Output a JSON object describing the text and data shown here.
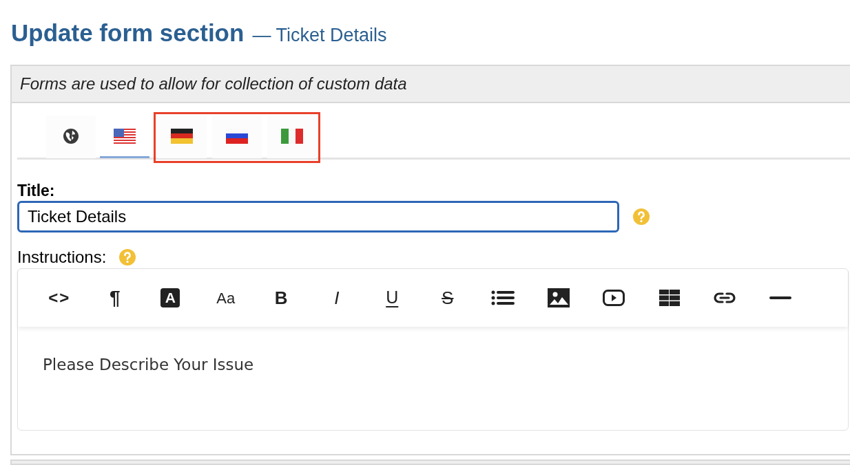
{
  "heading": {
    "title": "Update form section",
    "subtitle": "— Ticket Details"
  },
  "panel": {
    "description": "Forms are used to allow for collection of custom data"
  },
  "tabs": [
    {
      "kind": "globe",
      "selected": false,
      "highlighted": false
    },
    {
      "kind": "us",
      "selected": true,
      "highlighted": false
    },
    {
      "kind": "de",
      "selected": false,
      "highlighted": true
    },
    {
      "kind": "ru",
      "selected": false,
      "highlighted": true
    },
    {
      "kind": "it",
      "selected": false,
      "highlighted": true
    }
  ],
  "title_field": {
    "label": "Title:",
    "value": "Ticket Details"
  },
  "instructions": {
    "label": "Instructions:",
    "toolbar": [
      {
        "kind": "code",
        "label": "<>"
      },
      {
        "kind": "plain",
        "label": "¶"
      },
      {
        "kind": "inverse",
        "label": "A"
      },
      {
        "kind": "case",
        "label": "Aa"
      },
      {
        "kind": "bold",
        "label": "B"
      },
      {
        "kind": "italic",
        "label": "I"
      },
      {
        "kind": "underline",
        "label": "U"
      },
      {
        "kind": "strike",
        "label": "S"
      },
      {
        "kind": "list"
      },
      {
        "kind": "image"
      },
      {
        "kind": "video"
      },
      {
        "kind": "table"
      },
      {
        "kind": "link"
      },
      {
        "kind": "rule"
      }
    ],
    "content": "Please Describe Your Issue"
  }
}
